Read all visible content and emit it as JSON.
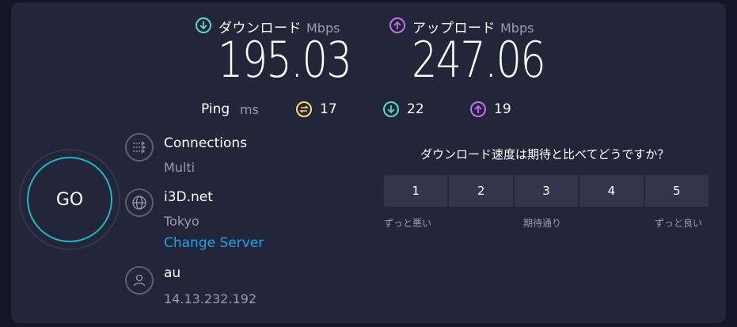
{
  "download": {
    "label": "ダウンロード",
    "unit": "Mbps",
    "value": "195.03",
    "icon": "download-arrow-icon",
    "color": "#5ad8d0"
  },
  "upload": {
    "label": "アップロード",
    "unit": "Mbps",
    "value": "247.06",
    "icon": "upload-arrow-icon",
    "color": "#bf71f2"
  },
  "ping": {
    "label": "Ping",
    "unit": "ms",
    "idle": {
      "value": "17",
      "icon": "idle-latency-icon",
      "color": "#ffdd57"
    },
    "download": {
      "value": "22",
      "icon": "download-latency-icon",
      "color": "#5ad8d0"
    },
    "upload": {
      "value": "19",
      "icon": "upload-latency-icon",
      "color": "#bf71f2"
    }
  },
  "go_button": {
    "label": "GO",
    "ring_color": "#1fb6c8"
  },
  "connections": {
    "title": "Connections",
    "value": "Multi",
    "icon": "connections-icon"
  },
  "server": {
    "name": "i3D.net",
    "location": "Tokyo",
    "change_label": "Change Server",
    "icon": "globe-icon"
  },
  "provider": {
    "name": "au",
    "ip": "14.13.232.192",
    "icon": "user-icon"
  },
  "survey": {
    "question": "ダウンロード速度は期待と比べてどうですか？",
    "options": [
      "1",
      "2",
      "3",
      "4",
      "5"
    ],
    "low_label": "ずっと悪い",
    "mid_label": "期待通り",
    "high_label": "ずっと良い"
  }
}
